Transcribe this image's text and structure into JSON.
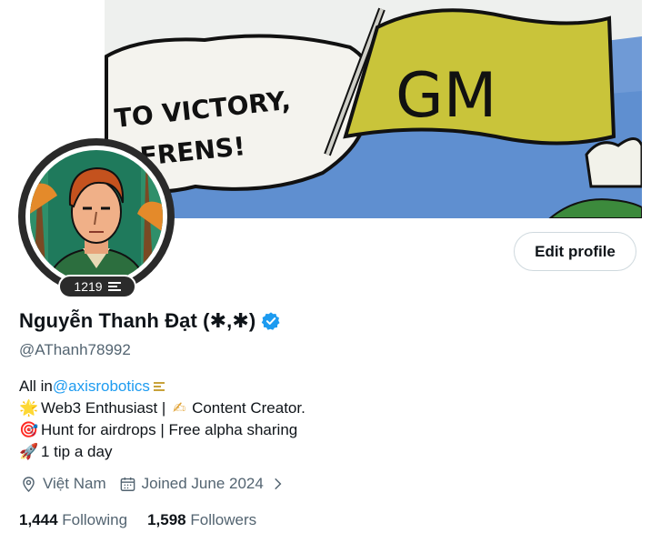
{
  "banner": {
    "speech_text_line1": "TO VICTORY,",
    "speech_text_line2": "FRENS!",
    "flag_text": "GM"
  },
  "avatar": {
    "badge_count": "1219",
    "badge_icon": "stack-icon"
  },
  "actions": {
    "edit_profile_label": "Edit profile"
  },
  "profile": {
    "name": "Nguyễn Thanh Đạt (✱,✱)",
    "verified_icon": "verified-badge-icon",
    "handle": "@AThanh78992"
  },
  "bio": {
    "line1_prefix": "All in ",
    "line1_mention": "@axisrobotics",
    "line2_emoji1": "🌟",
    "line2_text1": "Web3 Enthusiast | ",
    "line2_emoji2": "✍",
    "line2_text2": "Content Creator.",
    "line3_emoji": "🎯",
    "line3_text": "Hunt for airdrops | Free alpha sharing",
    "line4_emoji": "🚀",
    "line4_text": "1 tip a day"
  },
  "meta": {
    "location": "Việt Nam",
    "joined": "Joined June 2024"
  },
  "stats": {
    "following_count": "1,444",
    "following_label": "Following",
    "followers_count": "1,598",
    "followers_label": "Followers"
  },
  "colors": {
    "accent": "#1d9bf0",
    "muted": "#536471",
    "text": "#0f1419"
  }
}
